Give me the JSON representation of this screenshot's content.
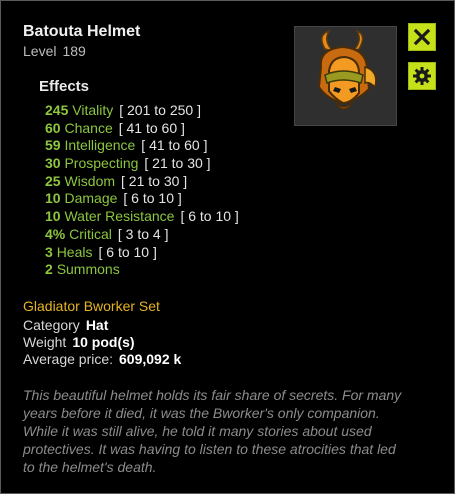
{
  "item": {
    "name": "Batouta Helmet",
    "level_label": "Level",
    "level": "189",
    "effects_title": "Effects",
    "effects": [
      {
        "amount": "245",
        "stat": "Vitality",
        "range": "[ 201 to 250 ]"
      },
      {
        "amount": "60",
        "stat": "Chance",
        "range": "[ 41 to 60 ]"
      },
      {
        "amount": "59",
        "stat": "Intelligence",
        "range": "[ 41 to 60 ]"
      },
      {
        "amount": "30",
        "stat": "Prospecting",
        "range": "[ 21 to 30 ]"
      },
      {
        "amount": "25",
        "stat": "Wisdom",
        "range": "[ 21 to 30 ]"
      },
      {
        "amount": "10",
        "stat": "Damage",
        "range": "[ 6 to 10 ]"
      },
      {
        "amount": "10",
        "stat": "Water Resistance",
        "range": "[ 6 to 10 ]"
      },
      {
        "amount": "4%",
        "stat": "Critical",
        "range": "[ 3 to 4 ]"
      },
      {
        "amount": "3",
        "stat": "Heals",
        "range": "[ 6 to 10 ]"
      },
      {
        "amount": "2",
        "stat": "Summons",
        "range": ""
      }
    ],
    "set_name": "Gladiator Bworker Set",
    "category_label": "Category",
    "category": "Hat",
    "weight_label": "Weight",
    "weight": "10 pod(s)",
    "price_label": "Average price:",
    "price": "609,092 k",
    "description": "This beautiful helmet holds its fair share of secrets. For many years before it died, it was the Bworker's only companion. While it was still alive, he told it many stories about used protectives. It was having to listen to these atrocities that led to the helmet's death."
  },
  "buttons": {
    "close_icon": "close-icon",
    "settings_icon": "gear-icon"
  },
  "colors": {
    "effect_green": "#8dc63f",
    "set_gold": "#e6b422",
    "button_accent": "#c6e01a",
    "panel_bg": "#000000"
  }
}
